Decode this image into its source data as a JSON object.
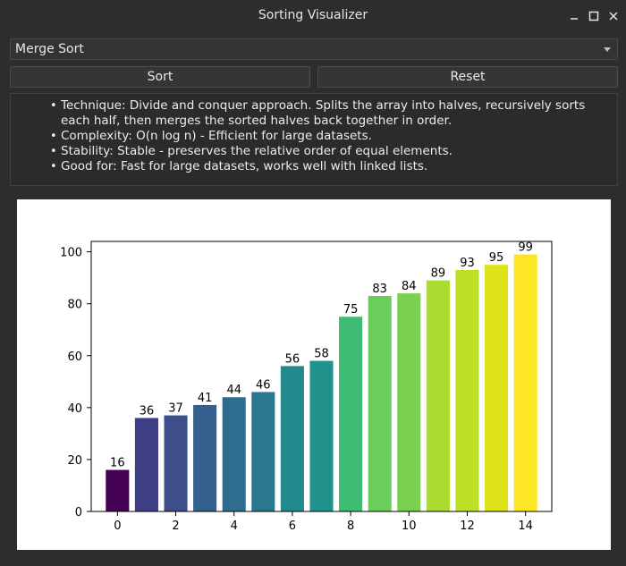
{
  "window": {
    "title": "Sorting Visualizer",
    "controls": [
      "minimize-icon",
      "maximize-icon",
      "close-icon"
    ]
  },
  "algorithm_select": {
    "selected": "Merge Sort"
  },
  "buttons": {
    "sort_label": "Sort",
    "reset_label": "Reset"
  },
  "info": {
    "bullet": "•",
    "lines": [
      "Technique: Divide and conquer approach. Splits the array into halves, recursively sorts each half, then merges the sorted halves back together in order.",
      "Complexity: O(n log n) - Efficient for large datasets.",
      "Stability: Stable - preserves the relative order of equal elements.",
      "Good for: Fast for large datasets, works well with linked lists."
    ]
  },
  "chart_data": {
    "type": "bar",
    "title": "",
    "xlabel": "",
    "ylabel": "",
    "categories": [
      0,
      1,
      2,
      3,
      4,
      5,
      6,
      7,
      8,
      9,
      10,
      11,
      12,
      13,
      14
    ],
    "values": [
      16,
      36,
      37,
      41,
      44,
      46,
      56,
      58,
      75,
      83,
      84,
      89,
      93,
      95,
      99
    ],
    "x_ticks": [
      0,
      2,
      4,
      6,
      8,
      10,
      12,
      14
    ],
    "y_ticks": [
      0,
      20,
      40,
      60,
      80,
      100
    ],
    "xlim": [
      -0.9,
      14.9
    ],
    "ylim": [
      0,
      104
    ],
    "colormap": "viridis",
    "bar_colors": [
      "#440154",
      "#3f3d86",
      "#3d4e8a",
      "#355f8d",
      "#2f6d8e",
      "#2a788e",
      "#228a8d",
      "#21918c",
      "#3fbc73",
      "#6ccd5a",
      "#7ad151",
      "#addc30",
      "#bddf26",
      "#dde318",
      "#fde725"
    ],
    "data_labels": true,
    "grid": false,
    "legend": "none"
  }
}
